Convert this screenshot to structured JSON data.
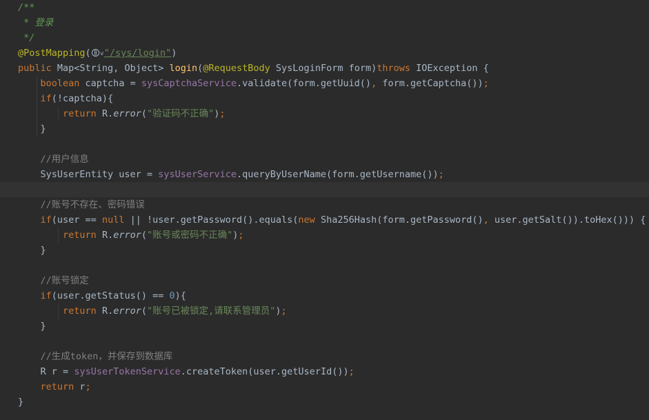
{
  "editor": {
    "colors": {
      "background": "#2b2b2b",
      "keyword": "#cc7832",
      "string": "#6a8759",
      "field": "#9876aa",
      "method": "#ffc66d",
      "comment": "#808080",
      "annotation": "#bbb529",
      "number": "#6897bb"
    },
    "icons": {
      "url_icon": "globe-icon",
      "url_chevron": "chevron-down-icon"
    },
    "lines": [
      {
        "t": [
          [
            "doc",
            "/**"
          ]
        ]
      },
      {
        "t": [
          [
            "doc",
            " * 登录"
          ]
        ]
      },
      {
        "t": [
          [
            "doc",
            " */"
          ]
        ]
      },
      {
        "t": [
          [
            "ann",
            "@PostMapping"
          ],
          [
            "id",
            "("
          ],
          [
            "icon",
            ""
          ],
          [
            "url",
            "\"/sys/login\""
          ],
          [
            "id",
            ")"
          ]
        ]
      },
      {
        "t": [
          [
            "kw",
            "public "
          ],
          [
            "id",
            "Map<String, Object> "
          ],
          [
            "fn",
            "login"
          ],
          [
            "id",
            "("
          ],
          [
            "ann",
            "@RequestBody "
          ],
          [
            "id",
            "SysLoginForm form)"
          ],
          [
            "kw",
            "throws "
          ],
          [
            "id",
            "IOException {"
          ]
        ]
      },
      {
        "t": [
          [
            "id",
            "    "
          ],
          [
            "kw",
            "boolean "
          ],
          [
            "id",
            "captcha = "
          ],
          [
            "field",
            "sysCaptchaService"
          ],
          [
            "id",
            ".validate(form.getUuid()"
          ],
          [
            "kw",
            ", "
          ],
          [
            "id",
            "form.getCaptcha())"
          ],
          [
            "kw",
            ";"
          ]
        ]
      },
      {
        "t": [
          [
            "id",
            "    "
          ],
          [
            "kw",
            "if"
          ],
          [
            "id",
            "(!captcha){"
          ]
        ]
      },
      {
        "t": [
          [
            "id",
            "        "
          ],
          [
            "kw",
            "return "
          ],
          [
            "id",
            "R."
          ],
          [
            "static",
            "error"
          ],
          [
            "id",
            "("
          ],
          [
            "str",
            "\"验证码不正确\""
          ],
          [
            "id",
            ")"
          ],
          [
            "kw",
            ";"
          ]
        ]
      },
      {
        "t": [
          [
            "id",
            "    }"
          ]
        ]
      },
      {
        "t": []
      },
      {
        "t": [
          [
            "id",
            "    "
          ],
          [
            "cm",
            "//用户信息"
          ]
        ]
      },
      {
        "t": [
          [
            "id",
            "    SysUserEntity user = "
          ],
          [
            "field",
            "sysUserService"
          ],
          [
            "id",
            ".queryByUserName(form.getUsername())"
          ],
          [
            "kw",
            ";"
          ]
        ]
      },
      {
        "t": [],
        "current": true
      },
      {
        "t": [
          [
            "id",
            "    "
          ],
          [
            "cm",
            "//账号不存在、密码错误"
          ]
        ]
      },
      {
        "t": [
          [
            "id",
            "    "
          ],
          [
            "kw",
            "if"
          ],
          [
            "id",
            "(user == "
          ],
          [
            "kw",
            "null "
          ],
          [
            "id",
            "|| !user.getPassword().equals("
          ],
          [
            "kw",
            "new "
          ],
          [
            "id",
            "Sha256Hash(form.getPassword()"
          ],
          [
            "kw",
            ", "
          ],
          [
            "id",
            "user.getSalt()).toHex())) {"
          ]
        ]
      },
      {
        "t": [
          [
            "id",
            "        "
          ],
          [
            "kw",
            "return "
          ],
          [
            "id",
            "R."
          ],
          [
            "static",
            "error"
          ],
          [
            "id",
            "("
          ],
          [
            "str",
            "\"账号或密码不正确\""
          ],
          [
            "id",
            ")"
          ],
          [
            "kw",
            ";"
          ]
        ]
      },
      {
        "t": [
          [
            "id",
            "    }"
          ]
        ]
      },
      {
        "t": []
      },
      {
        "t": [
          [
            "id",
            "    "
          ],
          [
            "cm",
            "//账号锁定"
          ]
        ]
      },
      {
        "t": [
          [
            "id",
            "    "
          ],
          [
            "kw",
            "if"
          ],
          [
            "id",
            "(user.getStatus() == "
          ],
          [
            "num",
            "0"
          ],
          [
            "id",
            "){"
          ]
        ]
      },
      {
        "t": [
          [
            "id",
            "        "
          ],
          [
            "kw",
            "return "
          ],
          [
            "id",
            "R."
          ],
          [
            "static",
            "error"
          ],
          [
            "id",
            "("
          ],
          [
            "str",
            "\"账号已被锁定,请联系管理员\""
          ],
          [
            "id",
            ")"
          ],
          [
            "kw",
            ";"
          ]
        ]
      },
      {
        "t": [
          [
            "id",
            "    }"
          ]
        ]
      },
      {
        "t": []
      },
      {
        "t": [
          [
            "id",
            "    "
          ],
          [
            "cm",
            "//生成token，并保存到数据库"
          ]
        ]
      },
      {
        "t": [
          [
            "id",
            "    R "
          ],
          [
            "hl",
            "r"
          ],
          [
            "id",
            " = "
          ],
          [
            "field",
            "sysUserTokenService"
          ],
          [
            "id",
            ".createToken(user.getUserId())"
          ],
          [
            "kw",
            ";"
          ]
        ]
      },
      {
        "t": [
          [
            "id",
            "    "
          ],
          [
            "kw",
            "return "
          ],
          [
            "id",
            "r"
          ],
          [
            "kw",
            ";"
          ]
        ]
      },
      {
        "t": [
          [
            "id",
            "}"
          ]
        ]
      }
    ]
  }
}
